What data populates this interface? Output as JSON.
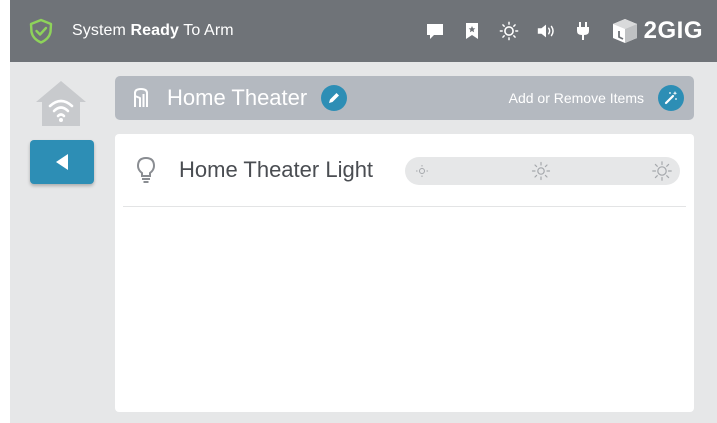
{
  "status_bar": {
    "status_prefix": "System ",
    "status_bold": "Ready",
    "status_suffix": " To Arm",
    "icons": [
      "shield-check-icon",
      "message-icon",
      "bookmark-icon",
      "brightness-icon",
      "volume-icon",
      "power-plug-icon"
    ],
    "brand": "2GIG"
  },
  "sidebar": {
    "home_icon": "home-wifi-icon",
    "back_icon": "back-arrow-icon"
  },
  "header": {
    "room_icon": "room-icon",
    "title": "Home Theater",
    "add_remove_label": "Add or Remove Items"
  },
  "devices": [
    {
      "label": "Home Theater Light",
      "icon": "light-bulb-icon",
      "dimmer_levels": [
        "off",
        "dim",
        "bright"
      ]
    }
  ],
  "colors": {
    "top_bar": "#6f7378",
    "accent": "#2d8eb5",
    "shield": "#8ed35a",
    "header_bar": "#b4b9c0",
    "content_bg": "#e6e7e8"
  }
}
